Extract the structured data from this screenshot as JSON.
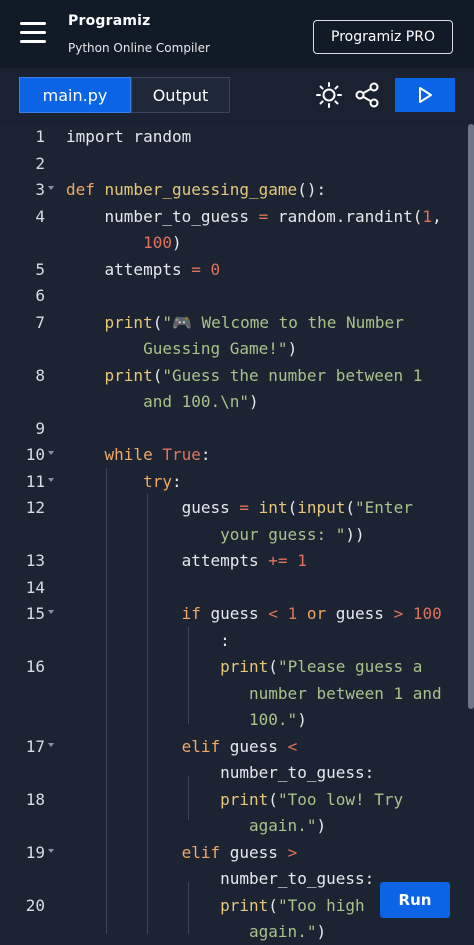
{
  "header": {
    "logo_text": "Programiz",
    "subtitle": "Python Online Compiler",
    "pro_button": "Programiz PRO"
  },
  "tabs": [
    {
      "label": "main.py",
      "active": true
    },
    {
      "label": "Output",
      "active": false
    }
  ],
  "toolbar": {
    "theme_icon": "sun-icon",
    "share_icon": "share-icon",
    "run_icon": "play-icon"
  },
  "editor": {
    "lines": [
      {
        "n": "1",
        "parts": [
          [
            "pl",
            "import random"
          ]
        ]
      },
      {
        "n": "2",
        "parts": []
      },
      {
        "n": "3",
        "parts": [
          [
            "kw",
            "def "
          ],
          [
            "fn",
            "number_guessing_game"
          ],
          [
            "pl",
            "():"
          ]
        ]
      },
      {
        "n": "4",
        "parts": [
          [
            "pl",
            "    number_to_guess "
          ],
          [
            "op",
            "="
          ],
          [
            "pl",
            " random.randint("
          ],
          [
            "num",
            "1"
          ],
          [
            "pl",
            ","
          ]
        ]
      },
      {
        "n": "",
        "parts": [
          [
            "pl",
            "        "
          ],
          [
            "num",
            "100"
          ],
          [
            "pl",
            ")"
          ]
        ]
      },
      {
        "n": "5",
        "parts": [
          [
            "pl",
            "    attempts "
          ],
          [
            "op",
            "="
          ],
          [
            "pl",
            " "
          ],
          [
            "num",
            "0"
          ]
        ]
      },
      {
        "n": "6",
        "parts": []
      },
      {
        "n": "7",
        "parts": [
          [
            "pl",
            "    "
          ],
          [
            "fn",
            "print"
          ],
          [
            "pl",
            "("
          ],
          [
            "str",
            "\"🎮 Welcome to the Number"
          ]
        ]
      },
      {
        "n": "",
        "parts": [
          [
            "str",
            "        Guessing Game!\""
          ],
          [
            "pl",
            ")"
          ]
        ]
      },
      {
        "n": "8",
        "parts": [
          [
            "pl",
            "    "
          ],
          [
            "fn",
            "print"
          ],
          [
            "pl",
            "("
          ],
          [
            "str",
            "\"Guess the number between 1"
          ]
        ]
      },
      {
        "n": "",
        "parts": [
          [
            "str",
            "        and 100.\\n\""
          ],
          [
            "pl",
            ")"
          ]
        ]
      },
      {
        "n": "9",
        "parts": []
      },
      {
        "n": "10",
        "parts": [
          [
            "pl",
            "    "
          ],
          [
            "kw",
            "while "
          ],
          [
            "num",
            "True"
          ],
          [
            "pl",
            ":"
          ]
        ]
      },
      {
        "n": "11",
        "parts": [
          [
            "pl",
            "        "
          ],
          [
            "kw",
            "try"
          ],
          [
            "pl",
            ":"
          ]
        ]
      },
      {
        "n": "12",
        "parts": [
          [
            "pl",
            "            guess "
          ],
          [
            "op",
            "="
          ],
          [
            "pl",
            " "
          ],
          [
            "fn",
            "int"
          ],
          [
            "pl",
            "("
          ],
          [
            "fn",
            "input"
          ],
          [
            "pl",
            "("
          ],
          [
            "str",
            "\"Enter"
          ]
        ]
      },
      {
        "n": "",
        "parts": [
          [
            "str",
            "                your guess: \""
          ],
          [
            "pl",
            "))"
          ]
        ]
      },
      {
        "n": "13",
        "parts": [
          [
            "pl",
            "            attempts "
          ],
          [
            "op",
            "+="
          ],
          [
            "pl",
            " "
          ],
          [
            "num",
            "1"
          ]
        ]
      },
      {
        "n": "14",
        "parts": []
      },
      {
        "n": "15",
        "parts": [
          [
            "pl",
            "            "
          ],
          [
            "kw",
            "if "
          ],
          [
            "pl",
            "guess "
          ],
          [
            "op",
            "<"
          ],
          [
            "pl",
            " "
          ],
          [
            "num",
            "1"
          ],
          [
            "pl",
            " "
          ],
          [
            "kw",
            "or"
          ],
          [
            "pl",
            " guess "
          ],
          [
            "op",
            ">"
          ],
          [
            "pl",
            " "
          ],
          [
            "num",
            "100"
          ]
        ]
      },
      {
        "n": "",
        "parts": [
          [
            "pl",
            "                :"
          ]
        ]
      },
      {
        "n": "16",
        "parts": [
          [
            "pl",
            "                "
          ],
          [
            "fn",
            "print"
          ],
          [
            "pl",
            "("
          ],
          [
            "str",
            "\"Please guess a"
          ]
        ]
      },
      {
        "n": "",
        "parts": [
          [
            "str",
            "                   number between 1 and"
          ]
        ]
      },
      {
        "n": "",
        "parts": [
          [
            "str",
            "                   100.\""
          ],
          [
            "pl",
            ")"
          ]
        ]
      },
      {
        "n": "17",
        "parts": [
          [
            "pl",
            "            "
          ],
          [
            "kw",
            "elif "
          ],
          [
            "pl",
            "guess "
          ],
          [
            "op",
            "<"
          ]
        ]
      },
      {
        "n": "",
        "parts": [
          [
            "pl",
            "                number_to_guess:"
          ]
        ]
      },
      {
        "n": "18",
        "parts": [
          [
            "pl",
            "                "
          ],
          [
            "fn",
            "print"
          ],
          [
            "pl",
            "("
          ],
          [
            "str",
            "\"Too low! Try"
          ]
        ]
      },
      {
        "n": "",
        "parts": [
          [
            "str",
            "                   again.\""
          ],
          [
            "pl",
            ")"
          ]
        ]
      },
      {
        "n": "19",
        "parts": [
          [
            "pl",
            "            "
          ],
          [
            "kw",
            "elif "
          ],
          [
            "pl",
            "guess "
          ],
          [
            "op",
            ">"
          ]
        ]
      },
      {
        "n": "",
        "parts": [
          [
            "pl",
            "                number_to_guess:"
          ]
        ]
      },
      {
        "n": "20",
        "parts": [
          [
            "pl",
            "                "
          ],
          [
            "fn",
            "print"
          ],
          [
            "pl",
            "("
          ],
          [
            "str",
            "\"Too high"
          ]
        ]
      },
      {
        "n": "",
        "parts": [
          [
            "str",
            "                   again.\""
          ],
          [
            "pl",
            ")"
          ]
        ]
      }
    ]
  },
  "run_button": "Run",
  "colors": {
    "accent": "#0b63e5",
    "background": "#1c2434",
    "keyword": "#f0a864",
    "function": "#e6c77a",
    "string": "#a8c28a",
    "number": "#e2725b"
  }
}
